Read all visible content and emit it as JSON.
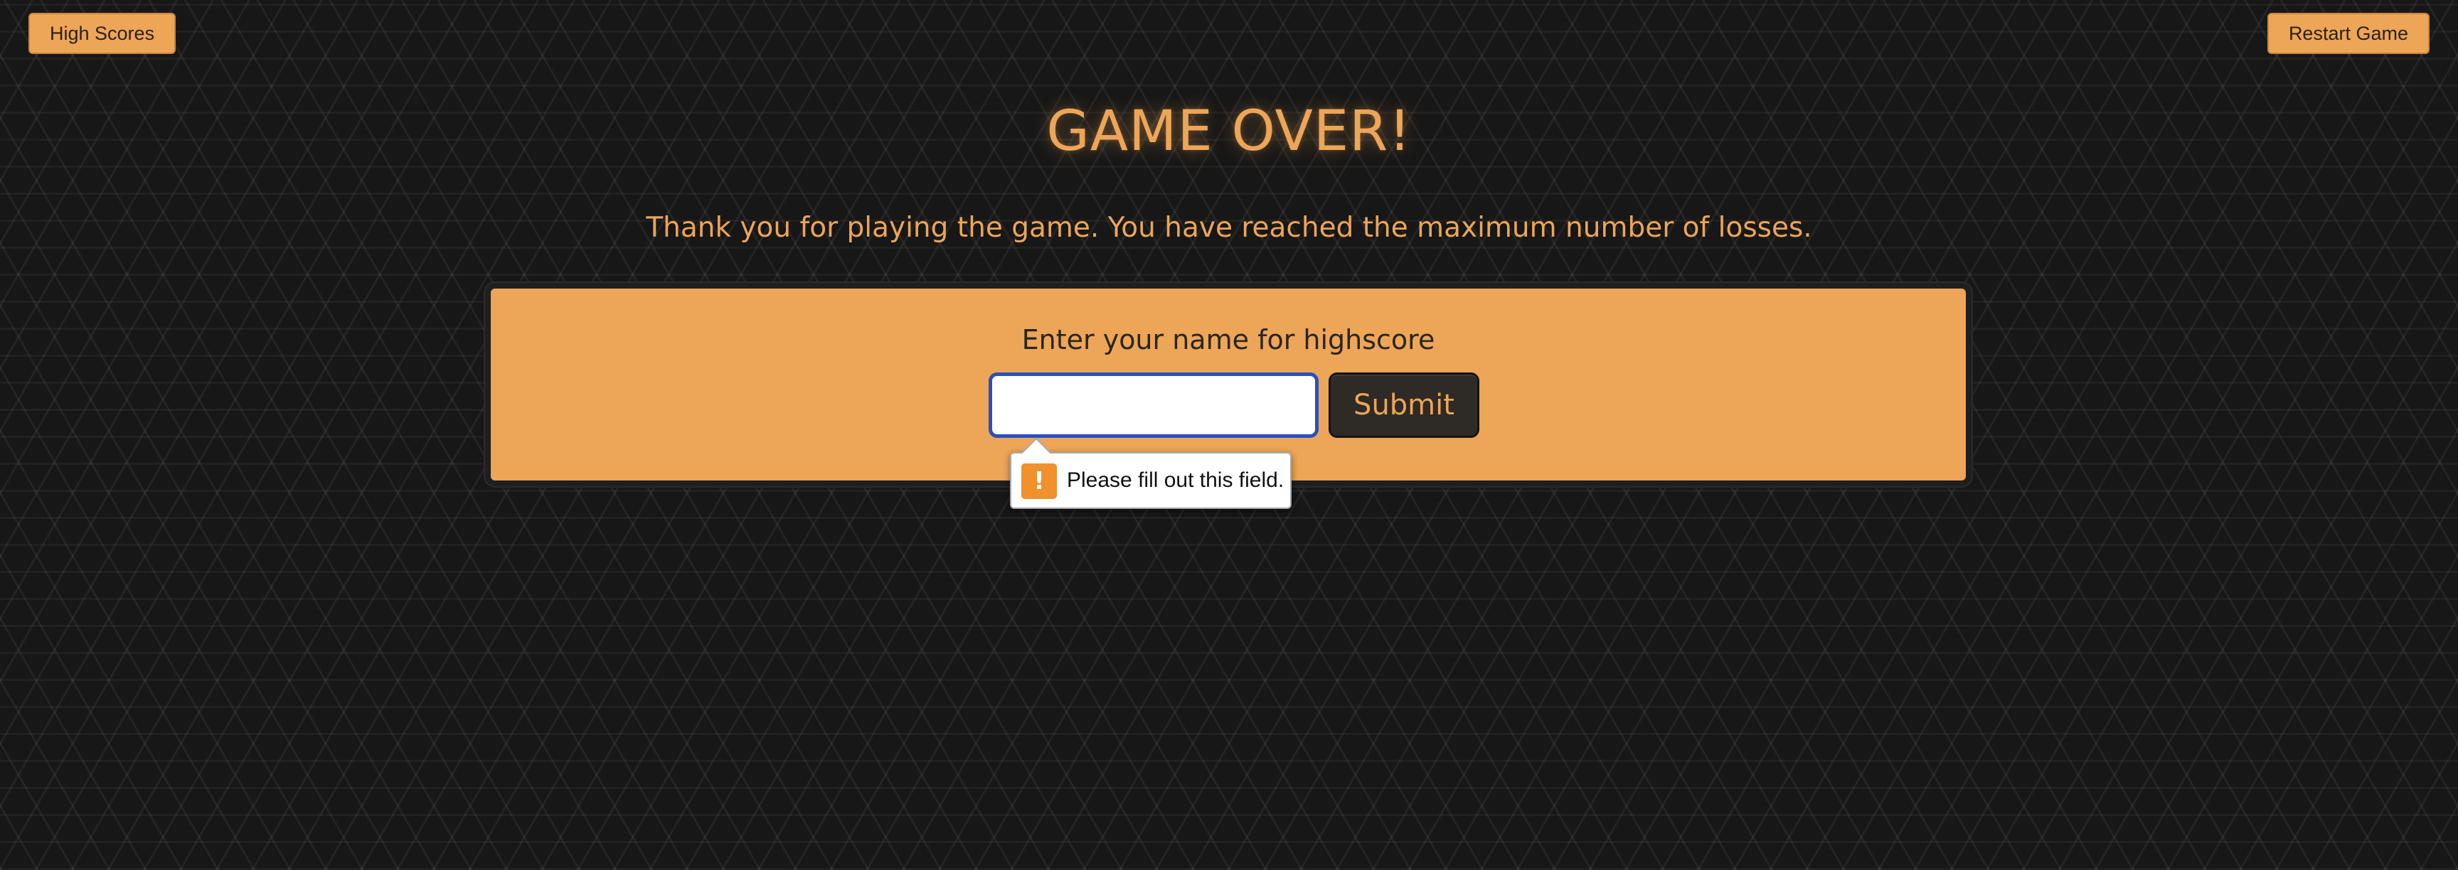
{
  "header": {
    "high_scores_label": "High Scores",
    "restart_label": "Restart Game"
  },
  "main": {
    "title": "GAME OVER!",
    "message": "Thank you for playing the game. You have reached the maximum number of losses."
  },
  "highscore_form": {
    "prompt": "Enter your name for highscore",
    "name_value": "",
    "submit_label": "Submit"
  },
  "validation": {
    "icon": "warning-icon",
    "icon_glyph": "!",
    "message": "Please fill out this field."
  },
  "colors": {
    "accent": "#eda557",
    "background": "#171717",
    "button_dark": "#2e2a26",
    "focus_ring": "#2a4fbf",
    "warning": "#f0912e"
  }
}
